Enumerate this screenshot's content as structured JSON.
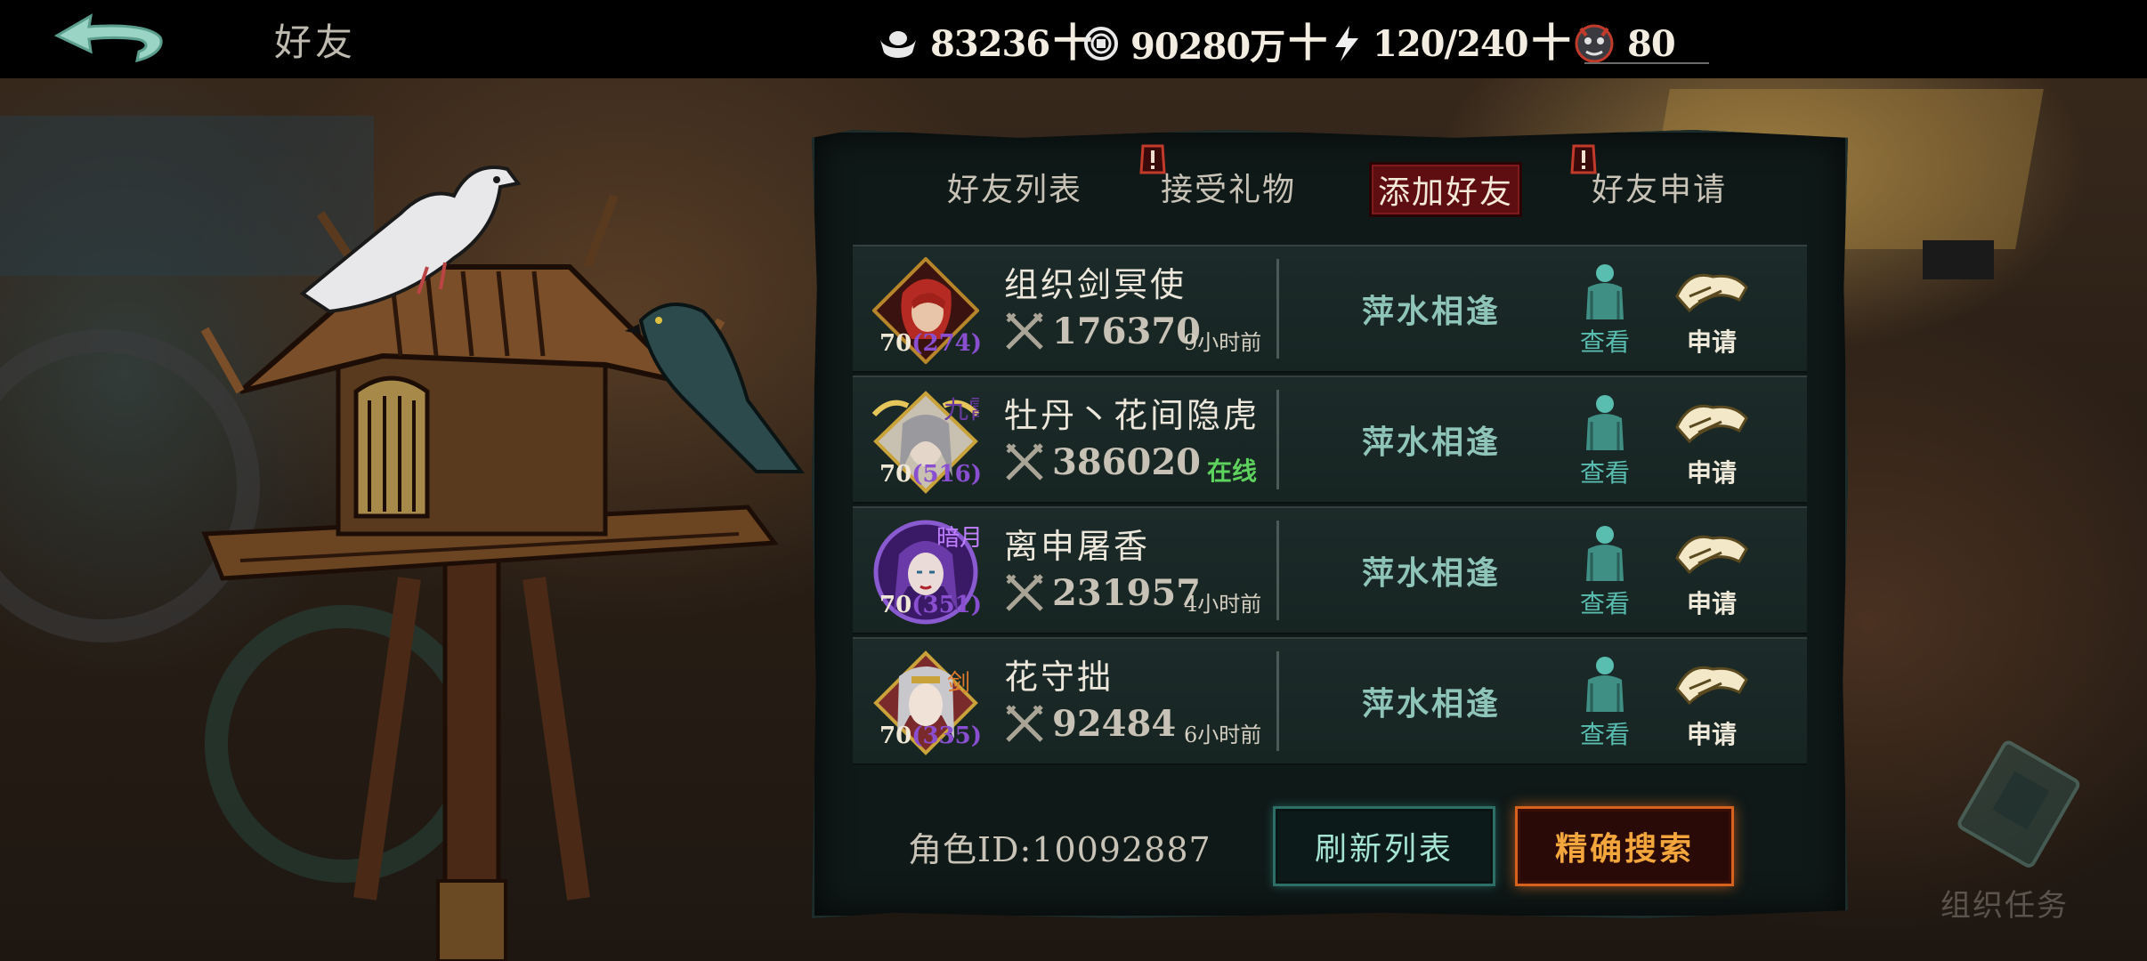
{
  "header": {
    "title": "好友",
    "resources": [
      {
        "icon": "silver-ingot-icon",
        "value": "83236",
        "suffix": "十"
      },
      {
        "icon": "copper-coin-icon",
        "value": "90280万",
        "suffix": "十"
      },
      {
        "icon": "lightning-energy-icon",
        "value": "120/240",
        "suffix": "十"
      },
      {
        "icon": "demon-mask-icon",
        "value": "80"
      }
    ]
  },
  "tabs": [
    {
      "label": "好友列表",
      "active": false,
      "alert": false
    },
    {
      "label": "接受礼物",
      "active": false,
      "alert": true
    },
    {
      "label": "添加好友",
      "active": true,
      "alert": false
    },
    {
      "label": "好友申请",
      "active": false,
      "alert": true
    }
  ],
  "players": [
    {
      "name": "组织剑冥使",
      "level": "70",
      "sub_level": "(274)",
      "power": "176370",
      "last_seen": "9小时前",
      "relation": "萍水相逢",
      "view_label": "查看",
      "apply_label": "申请",
      "avatar": "red-hair-swordsman-avatar"
    },
    {
      "name": "牡丹丶花间隐虎",
      "level": "70",
      "sub_level": "(516)",
      "power": "386020",
      "last_seen": "在线",
      "online": true,
      "relation": "萍水相逢",
      "view_label": "查看",
      "apply_label": "申请",
      "avatar": "white-hair-warrior-avatar",
      "badge": "九霄"
    },
    {
      "name": "离申屠香",
      "level": "70",
      "sub_level": "(351)",
      "power": "231957",
      "last_seen": "4小时前",
      "relation": "萍水相逢",
      "view_label": "查看",
      "apply_label": "申请",
      "avatar": "purple-hair-woman-avatar",
      "badge": "暗月"
    },
    {
      "name": "花守拙",
      "level": "70",
      "sub_level": "(335)",
      "power": "92484",
      "last_seen": "6小时前",
      "relation": "萍水相逢",
      "view_label": "查看",
      "apply_label": "申请",
      "avatar": "silver-hair-man-avatar",
      "badge": "剑"
    }
  ],
  "footer": {
    "role_id": "角色ID:10092887",
    "refresh_label": "刷新列表",
    "search_label": "精确搜索"
  },
  "background_labels": [
    "组织任务"
  ],
  "colors": {
    "active_tab": "#5e0d10",
    "online": "#5dd25d",
    "fate_text": "#8fc4b8",
    "search_border": "#d7621d",
    "refresh_border": "#2d6e66"
  }
}
